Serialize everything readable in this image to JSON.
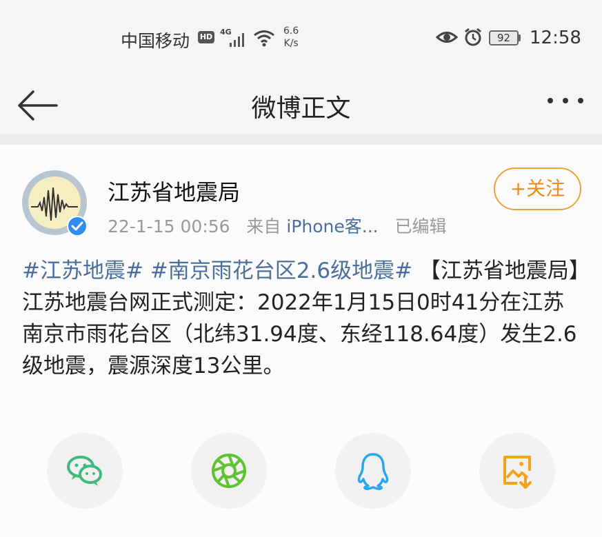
{
  "status_bar": {
    "carrier": "中国移动",
    "hd": "HD",
    "network": "4G",
    "speed_value": "6.6",
    "speed_unit": "K/s",
    "battery": "92",
    "time": "12:58"
  },
  "header": {
    "title": "微博正文",
    "back_icon": "arrow-left-icon",
    "more_icon": "more-dots-icon"
  },
  "post": {
    "author": "江苏省地震局",
    "date": "22-1-15 00:56",
    "source_prefix": "来自",
    "source": "iPhone客...",
    "edited": "已编辑",
    "follow_label": "+关注",
    "tag1": "#江苏地震#",
    "tag2": "#南京雨花台区2.6级地震#",
    "text": "【江苏省地震局】江苏地震台网正式测定：2022年1月15日0时41分在江苏南京市雨花台区（北纬31.94度、东经118.64度）发生2.6级地震，震源深度13公里。"
  },
  "share": [
    {
      "icon": "wechat-icon",
      "color": "#3dba7c"
    },
    {
      "icon": "moments-icon",
      "color": "#5fc232"
    },
    {
      "icon": "qq-icon",
      "color": "#2aa6ef"
    },
    {
      "icon": "save-image-icon",
      "color": "#f4a11c"
    }
  ]
}
